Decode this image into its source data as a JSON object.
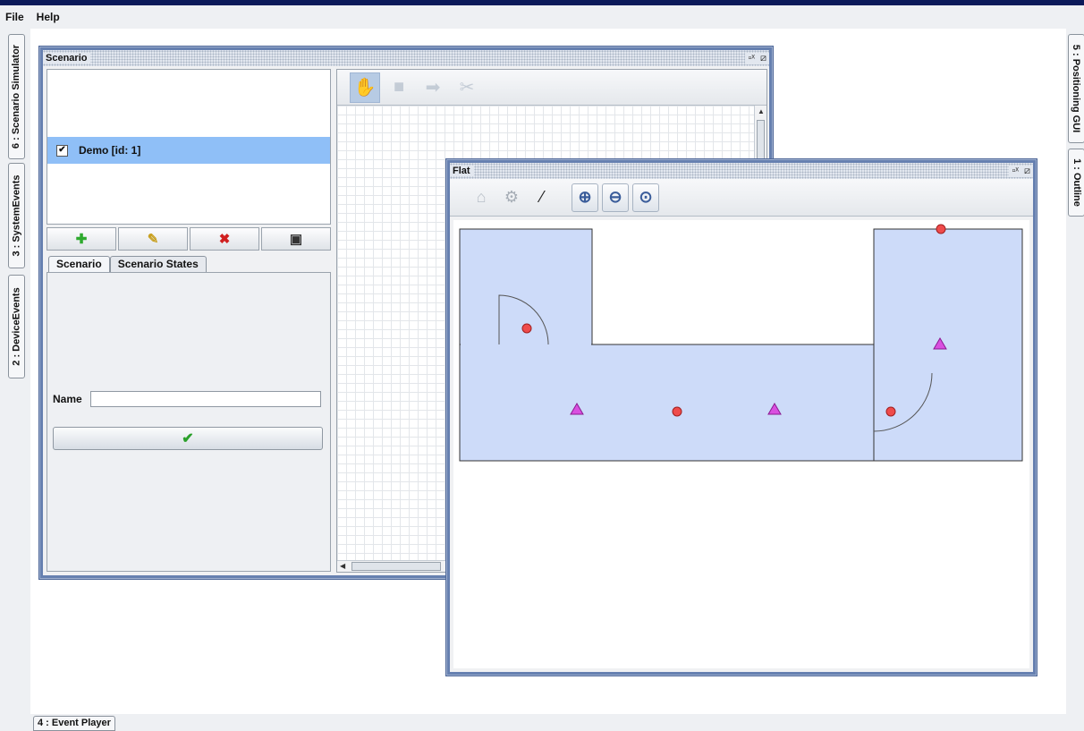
{
  "menu": {
    "file": "File",
    "help": "Help"
  },
  "docks": {
    "left_tabs": [
      "6 : Scenario Simulator",
      "3 : SystemEvents",
      "2 : DeviceEvents"
    ],
    "right_tabs": [
      "5 : Positioning GUI",
      "1 : Outline"
    ],
    "bottom_tabs": [
      "4 : Event Player"
    ]
  },
  "scenario_window": {
    "title": "Scenario",
    "list_items": [
      {
        "label": "Demo [id: 1]",
        "checked": true,
        "selected": true
      }
    ],
    "buttons": {
      "add_icon": "plus-icon",
      "edit_icon": "pencil-icon",
      "delete_icon": "delete-x-icon",
      "save_icon": "floppy-disk-icon"
    },
    "tabs": [
      "Scenario",
      "Scenario States"
    ],
    "active_tab": "Scenario",
    "name_label": "Name",
    "name_value": "",
    "confirm_icon": "checkmark-icon",
    "toolbar_icons": [
      "hand-icon",
      "stop-icon",
      "arrow-icon",
      "scissors-icon"
    ]
  },
  "flat_window": {
    "title": "Flat",
    "toolbar_icons": [
      "home-icon",
      "gear-icon",
      "magic-wand-icon",
      "zoom-in-icon",
      "zoom-out-icon",
      "zoom-fit-icon"
    ],
    "colors": {
      "room_fill": "#cddbf9",
      "wall": "#333333",
      "sensor": "#ef4b4b",
      "device": "#d94fe0"
    }
  }
}
